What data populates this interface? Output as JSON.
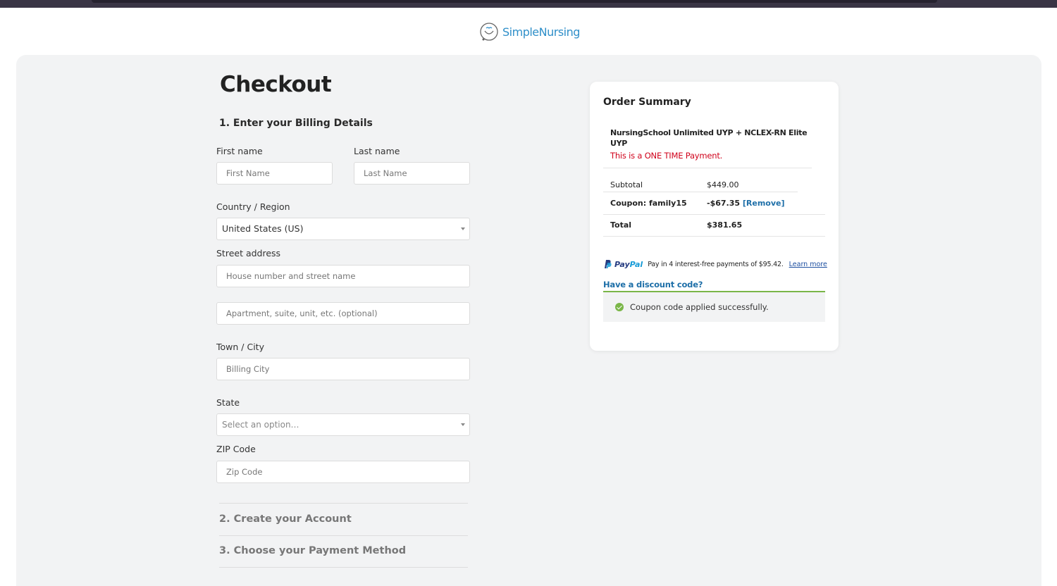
{
  "brand": {
    "name": "SimpleNursing",
    "logo_icon": "smile-heart-icon"
  },
  "checkout": {
    "title": "Checkout",
    "section1": "1. Enter your Billing Details",
    "first_name": {
      "label": "First name",
      "placeholder": "First Name",
      "value": ""
    },
    "last_name": {
      "label": "Last name",
      "placeholder": "Last Name",
      "value": ""
    },
    "country": {
      "label": "Country / Region",
      "value": "United States (US)"
    },
    "street": {
      "label": "Street address",
      "placeholder": "House number and street name",
      "placeholder2": "Apartment, suite, unit, etc. (optional)"
    },
    "city": {
      "label": "Town / City",
      "placeholder": "Billing City"
    },
    "state": {
      "label": "State",
      "placeholder": "Select an option…"
    },
    "zip": {
      "label": "ZIP Code",
      "placeholder": "Zip Code"
    },
    "section2": "2. Create your Account",
    "section3": "3. Choose your Payment Method"
  },
  "summary": {
    "title": "Order Summary",
    "product": "NursingSchool Unlimited UYP + NCLEX-RN Elite UYP",
    "note": "This is a ONE TIME Payment.",
    "subtotal_label": "Subtotal",
    "subtotal_value": "$449.00",
    "coupon_label": "Coupon: family15",
    "coupon_value": "-$67.35",
    "coupon_remove": "[Remove]",
    "total_label": "Total",
    "total_value": "$381.65",
    "paypal": {
      "brand_pay": "Pay",
      "brand_pal": "Pal",
      "message": "Pay in 4 interest-free payments of $95.42.",
      "learn_more": "Learn more"
    },
    "discount_link": "Have a discount code?",
    "coupon_notice": "Coupon code applied successfully."
  },
  "colors": {
    "accent_blue": "#1e6fa8",
    "success_green": "#7ab648",
    "warning_red": "#d0021b",
    "panel_bg": "#f2f3f4"
  }
}
